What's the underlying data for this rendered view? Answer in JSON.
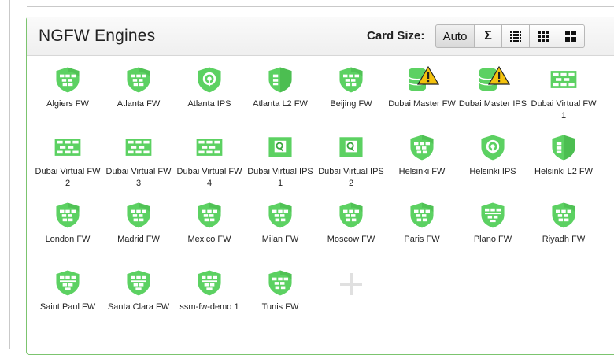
{
  "panel": {
    "title": "NGFW Engines",
    "card_size_label": "Card Size:",
    "card_size_buttons": [
      {
        "label": "Auto",
        "icon": "auto",
        "selected": true
      },
      {
        "label": "Σ",
        "icon": "sigma-icon"
      },
      {
        "label": "",
        "icon": "small-grid-icon"
      },
      {
        "label": "",
        "icon": "medium-grid-icon"
      },
      {
        "label": "",
        "icon": "large-grid-icon"
      }
    ]
  },
  "colors": {
    "icon_green": "#5cd162",
    "icon_green_dark": "#3aa63f",
    "warning_yellow": "#f4c20d",
    "panel_border": "#7cc46f"
  },
  "engines": [
    {
      "name": "Algiers FW",
      "icon": "firewall-shield-icon"
    },
    {
      "name": "Atlanta FW",
      "icon": "firewall-shield-icon"
    },
    {
      "name": "Atlanta IPS",
      "icon": "ips-shield-icon"
    },
    {
      "name": "Atlanta L2 FW",
      "icon": "l2-shield-icon"
    },
    {
      "name": "Beijing FW",
      "icon": "firewall-shield-icon"
    },
    {
      "name": "Dubai Master FW",
      "icon": "database-warning-icon"
    },
    {
      "name": "Dubai Master IPS",
      "icon": "database-warning-icon"
    },
    {
      "name": "Dubai Virtual FW 1",
      "icon": "virtual-firewall-icon"
    },
    {
      "name": "Dubai Virtual FW 2",
      "icon": "virtual-firewall-icon"
    },
    {
      "name": "Dubai Virtual FW 3",
      "icon": "virtual-firewall-icon"
    },
    {
      "name": "Dubai Virtual FW 4",
      "icon": "virtual-firewall-icon"
    },
    {
      "name": "Dubai Virtual IPS 1",
      "icon": "virtual-ips-icon"
    },
    {
      "name": "Dubai Virtual IPS 2",
      "icon": "virtual-ips-icon"
    },
    {
      "name": "Helsinki FW",
      "icon": "firewall-shield-icon"
    },
    {
      "name": "Helsinki IPS",
      "icon": "ips-shield-icon"
    },
    {
      "name": "Helsinki L2 FW",
      "icon": "l2-shield-icon"
    },
    {
      "name": "London FW",
      "icon": "firewall-shield-icon"
    },
    {
      "name": "Madrid FW",
      "icon": "firewall-shield-icon"
    },
    {
      "name": "Mexico FW",
      "icon": "firewall-shield-icon"
    },
    {
      "name": "Milan FW",
      "icon": "firewall-shield-icon"
    },
    {
      "name": "Moscow FW",
      "icon": "firewall-shield-icon"
    },
    {
      "name": "Paris FW",
      "icon": "firewall-shield-icon"
    },
    {
      "name": "Plano FW",
      "icon": "firewall-shield-solid-icon"
    },
    {
      "name": "Riyadh FW",
      "icon": "firewall-shield-icon"
    },
    {
      "name": "Saint Paul FW",
      "icon": "firewall-shield-solid-icon"
    },
    {
      "name": "Santa Clara FW",
      "icon": "firewall-shield-solid-icon"
    },
    {
      "name": "ssm-fw-demo 1",
      "icon": "firewall-shield-solid-icon"
    },
    {
      "name": "Tunis FW",
      "icon": "firewall-shield-icon"
    }
  ],
  "add_card": {
    "icon": "plus-icon"
  }
}
